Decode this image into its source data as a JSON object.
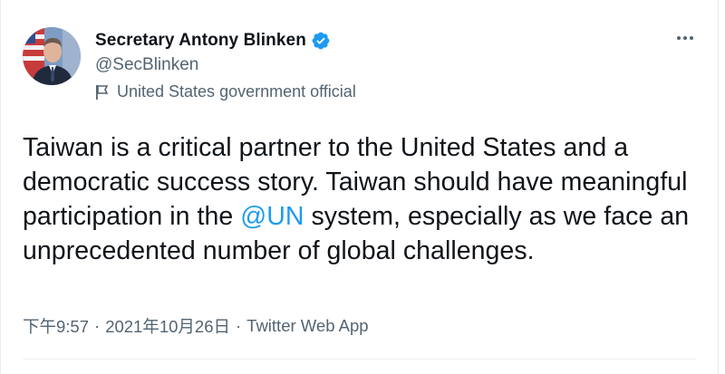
{
  "author": {
    "display_name": "Secretary Antony Blinken",
    "handle": "@SecBlinken",
    "label": "United States government official"
  },
  "tweet": {
    "text_before": "Taiwan is a critical partner to the United States and a democratic success story. Taiwan should have meaningful participation in the ",
    "mention": "@UN",
    "text_after": " system, especially as we face an unprecedented number of global challenges."
  },
  "meta": {
    "time": "下午9:57",
    "separator": "·",
    "date": "2021年10月26日",
    "source": "Twitter Web App"
  },
  "colors": {
    "accent": "#1d9bf0",
    "secondary_text": "#536471",
    "primary_text": "#0f1419"
  },
  "icons": {
    "verified": "verified-badge-icon",
    "government_label": "flag-icon",
    "more": "more-options-icon"
  }
}
